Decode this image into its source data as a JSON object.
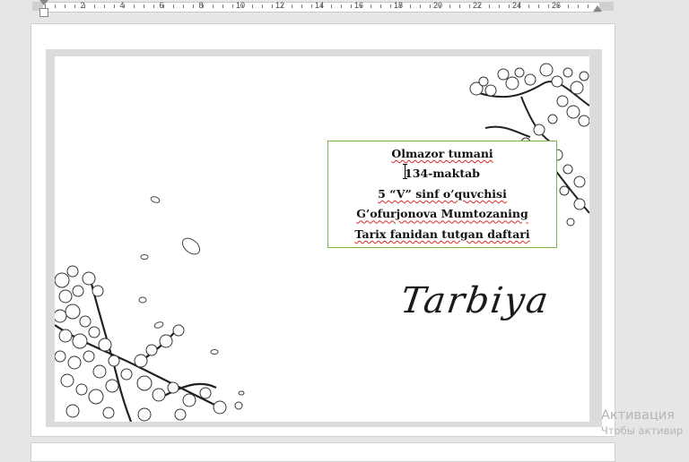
{
  "ruler": {
    "numbers": [
      "2",
      "4",
      "6",
      "8",
      "10",
      "12",
      "14",
      "16",
      "18",
      "20",
      "22",
      "24",
      "26"
    ]
  },
  "document": {
    "textbox_lines": [
      "Olmazor tumani",
      "134-maktab",
      "5 “V” sinf o’quvchisi",
      "G’ofurjonova Mumtozaning",
      "Tarix fanidan tutgan daftari"
    ],
    "title_script": "Tarbiya"
  },
  "watermark": {
    "title": "Активация",
    "subtitle": "Чтобы активир"
  },
  "colors": {
    "textbox_border": "#7ab648",
    "spellcheck": "#d42a2a",
    "workspace": "#e6e6e6"
  }
}
